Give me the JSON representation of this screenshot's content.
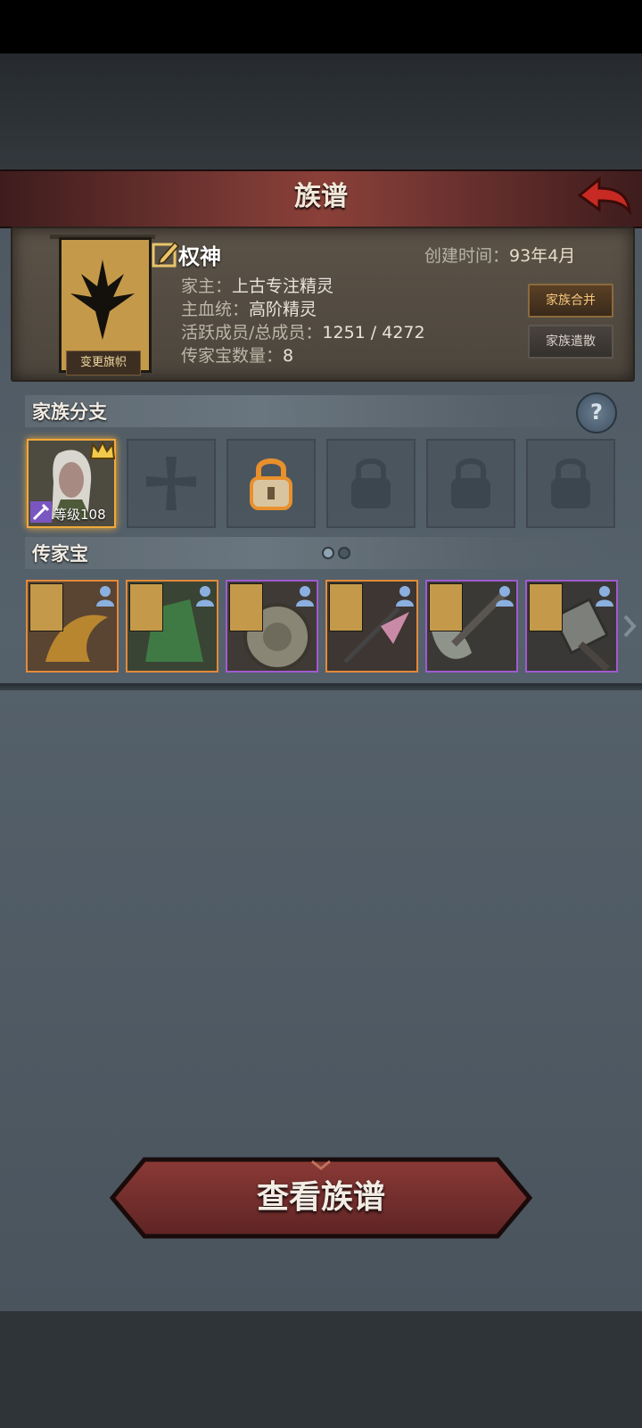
{
  "header": {
    "title": "族谱"
  },
  "clan": {
    "change_flag_label": "变更旗帜",
    "name": "权神",
    "created_label": "创建时间：",
    "created_value": "93年4月",
    "leader_label": "家主：",
    "leader_value": "上古专注精灵",
    "bloodline_label": "主血统：",
    "bloodline_value": "高阶精灵",
    "members_label": "活跃成员/总成员：",
    "members_value": "1251 / 4272",
    "heirloom_count_label": "传家宝数量：",
    "heirloom_count_value": "8",
    "merge_button": "家族合并",
    "disband_button": "家族遣散"
  },
  "branches": {
    "title": "家族分支",
    "help_icon": "?",
    "slots": [
      {
        "state": "owned",
        "level_label": "等级108"
      },
      {
        "state": "empty-cross"
      },
      {
        "state": "locked-highlight"
      },
      {
        "state": "locked"
      },
      {
        "state": "locked"
      },
      {
        "state": "locked"
      }
    ]
  },
  "heirlooms": {
    "title": "传家宝",
    "items": [
      {
        "rarity": "orange",
        "icon": "dragon-armor-icon"
      },
      {
        "rarity": "orange",
        "icon": "green-armor-icon"
      },
      {
        "rarity": "purple",
        "icon": "shield-icon"
      },
      {
        "rarity": "orange",
        "icon": "spear-icon"
      },
      {
        "rarity": "purple",
        "icon": "axe-icon"
      },
      {
        "rarity": "purple",
        "icon": "hammer-icon"
      }
    ]
  },
  "footer": {
    "view_button": "查看族谱"
  },
  "colors": {
    "accent_orange": "#f0a93a",
    "purple": "#a05ad0",
    "title_red": "#7c3a35"
  }
}
